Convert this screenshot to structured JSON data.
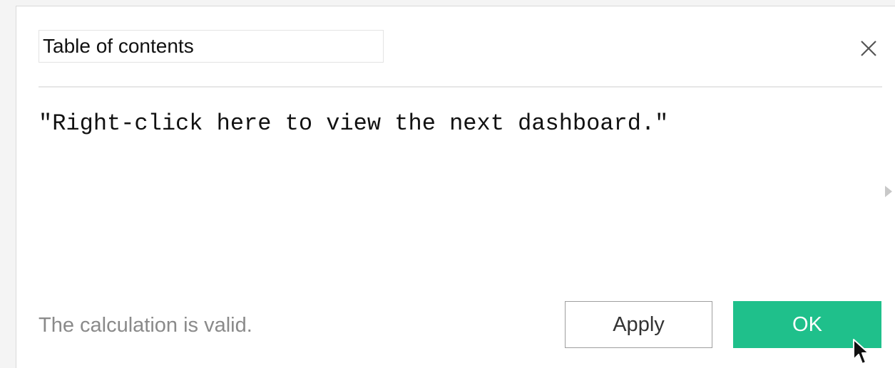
{
  "dialog": {
    "calc_name": "Table of contents",
    "formula": "\"Right-click here to view the next dashboard.\"",
    "status": "The calculation is valid.",
    "apply_label": "Apply",
    "ok_label": "OK",
    "close_icon": "close-icon",
    "expand_icon": "chevron-right-icon",
    "cursor_icon": "mouse-pointer-icon",
    "ok_color": "#1fc08b",
    "status_color": "#8a8a8a"
  }
}
